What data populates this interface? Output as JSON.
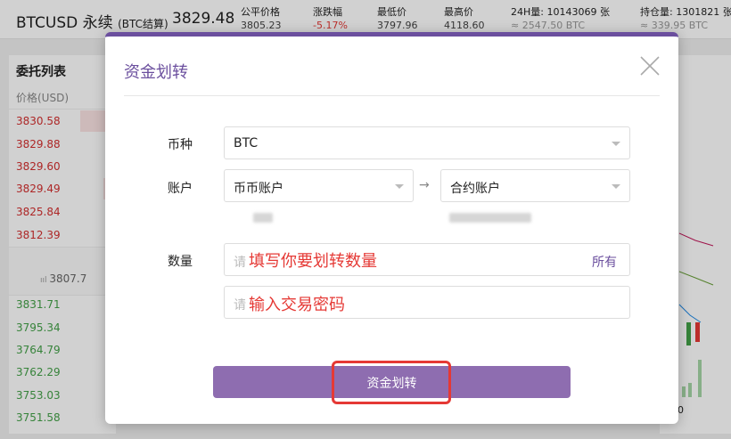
{
  "ticker": {
    "symbol": "BTCUSD 永续",
    "settle": "(BTC结算)",
    "price": "3829.48",
    "stats": [
      {
        "label": "公平价格",
        "value": "3805.23",
        "tone": "normal"
      },
      {
        "label": "涨跌幅",
        "value": "-5.17%",
        "tone": "red"
      },
      {
        "label": "最低价",
        "value": "3797.96",
        "tone": "normal"
      },
      {
        "label": "最高价",
        "value": "4118.60",
        "tone": "normal"
      },
      {
        "label": "24H量: 10143069 张",
        "value": "≈ 2547.50 BTC",
        "tone": "grey"
      },
      {
        "label": "持仓量: 1301821 张",
        "value": "≈ 339.95 BTC",
        "tone": "grey"
      }
    ]
  },
  "order_book": {
    "title": "委托列表",
    "price_header": "价格(USD)",
    "asks": [
      "3830.58",
      "3829.88",
      "3829.60",
      "3829.49",
      "3825.84",
      "3812.39"
    ],
    "mid_price": "3807.7",
    "bids": [
      "3831.71",
      "3795.34",
      "3764.79",
      "3762.29",
      "3753.03",
      "3751.58"
    ]
  },
  "modal": {
    "title": "资金划转",
    "currency_label": "币种",
    "currency_value": "BTC",
    "account_label": "账户",
    "from_account": "币币账户",
    "to_account": "合约账户",
    "amount_label": "数量",
    "amount_placeholder": "请",
    "amount_all": "所有",
    "password_placeholder": "请",
    "submit_label": "资金划转"
  },
  "annotations": {
    "amount_hint": "填写你要划转数量",
    "password_hint": "输入交易密码",
    "highlight_color": "#e53935"
  },
  "colors": {
    "accent": "#6b4f9e",
    "button": "#8e6db0",
    "ask": "#d32f2f",
    "bid": "#43a047"
  }
}
